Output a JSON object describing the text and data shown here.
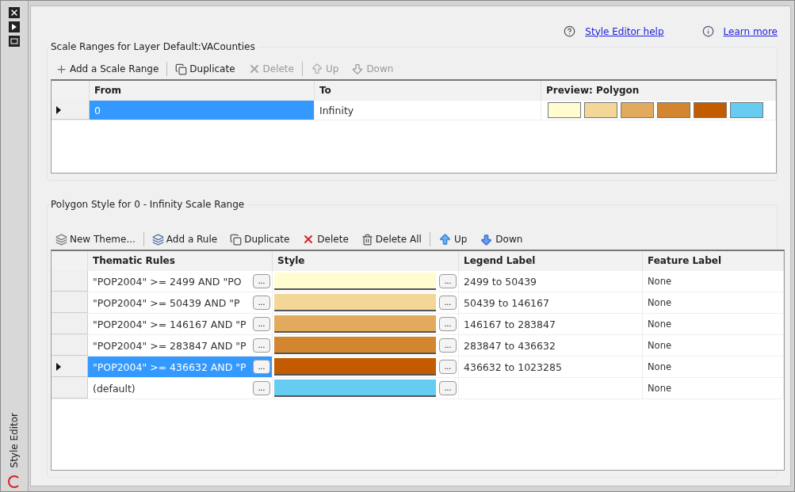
{
  "side_title": "Style Editor",
  "links": [
    {
      "label": "Style Editor help",
      "kind": "help"
    },
    {
      "label": "Learn more",
      "kind": "info"
    }
  ],
  "scale_ranges": {
    "title": "Scale Ranges for Layer Default:VACounties",
    "toolbar": [
      {
        "label": "Add a Scale Range",
        "kind": "add-range",
        "disabled": false
      },
      {
        "label": "Duplicate",
        "kind": "duplicate",
        "disabled": false
      },
      {
        "label": "Delete",
        "kind": "delete",
        "disabled": true
      },
      {
        "label": "Up",
        "kind": "up",
        "disabled": true
      },
      {
        "label": "Down",
        "kind": "down",
        "disabled": true
      }
    ],
    "columns": [
      "From",
      "To",
      "Preview: Polygon"
    ],
    "rows": [
      {
        "from": "0",
        "to": "Infinity",
        "selected": true,
        "preview": [
          {
            "color": "#fffdd0"
          },
          {
            "color": "#f2d796"
          },
          {
            "color": "#e2aa5c"
          },
          {
            "color": "#d3852f"
          },
          {
            "color": "#c35b00"
          },
          {
            "color": "#66ccf2"
          }
        ]
      }
    ]
  },
  "polygon_style": {
    "title": "Polygon Style for 0 - Infinity Scale Range",
    "toolbar": [
      {
        "label": "New Theme...",
        "kind": "theme",
        "disabled": false
      },
      {
        "label": "Add a Rule",
        "kind": "add-rule",
        "disabled": false
      },
      {
        "label": "Duplicate",
        "kind": "duplicate",
        "disabled": false
      },
      {
        "label": "Delete",
        "kind": "delete-red",
        "disabled": false
      },
      {
        "label": "Delete All",
        "kind": "delete-all",
        "disabled": false
      },
      {
        "label": "Up",
        "kind": "up-blue",
        "disabled": false
      },
      {
        "label": "Down",
        "kind": "down-blue",
        "disabled": false
      }
    ],
    "columns": [
      "Thematic Rules",
      "Style",
      "Legend Label",
      "Feature Label"
    ],
    "browse_buttons": [
      {
        "rule": "...",
        "style": "..."
      },
      {
        "rule": "...",
        "style": "..."
      },
      {
        "rule": "...",
        "style": "..."
      },
      {
        "rule": "...",
        "style": "..."
      },
      {
        "rule": "...",
        "style": "..."
      },
      {
        "rule": "...",
        "style": "..."
      }
    ],
    "rows": [
      {
        "rule": "\"POP2004\" >= 2499 AND \"PO",
        "color": "#fffdd0",
        "legend": "2499 to 50439",
        "feature": "None",
        "selected": false
      },
      {
        "rule": "\"POP2004\" >= 50439 AND \"P",
        "color": "#f2d796",
        "legend": "50439 to 146167",
        "feature": "None",
        "selected": false
      },
      {
        "rule": "\"POP2004\" >= 146167 AND \"P",
        "color": "#e2aa5c",
        "legend": "146167 to 283847",
        "feature": "None",
        "selected": false
      },
      {
        "rule": "\"POP2004\" >= 283847 AND \"P",
        "color": "#d3852f",
        "legend": "283847 to 436632",
        "feature": "None",
        "selected": false
      },
      {
        "rule": "\"POP2004\" >= 436632 AND \"P",
        "color": "#c35b00",
        "legend": "436632 to 1023285",
        "feature": "None",
        "selected": true
      },
      {
        "rule": "(default)",
        "color": "#66ccf2",
        "legend": "",
        "feature": "None",
        "selected": false
      }
    ]
  }
}
